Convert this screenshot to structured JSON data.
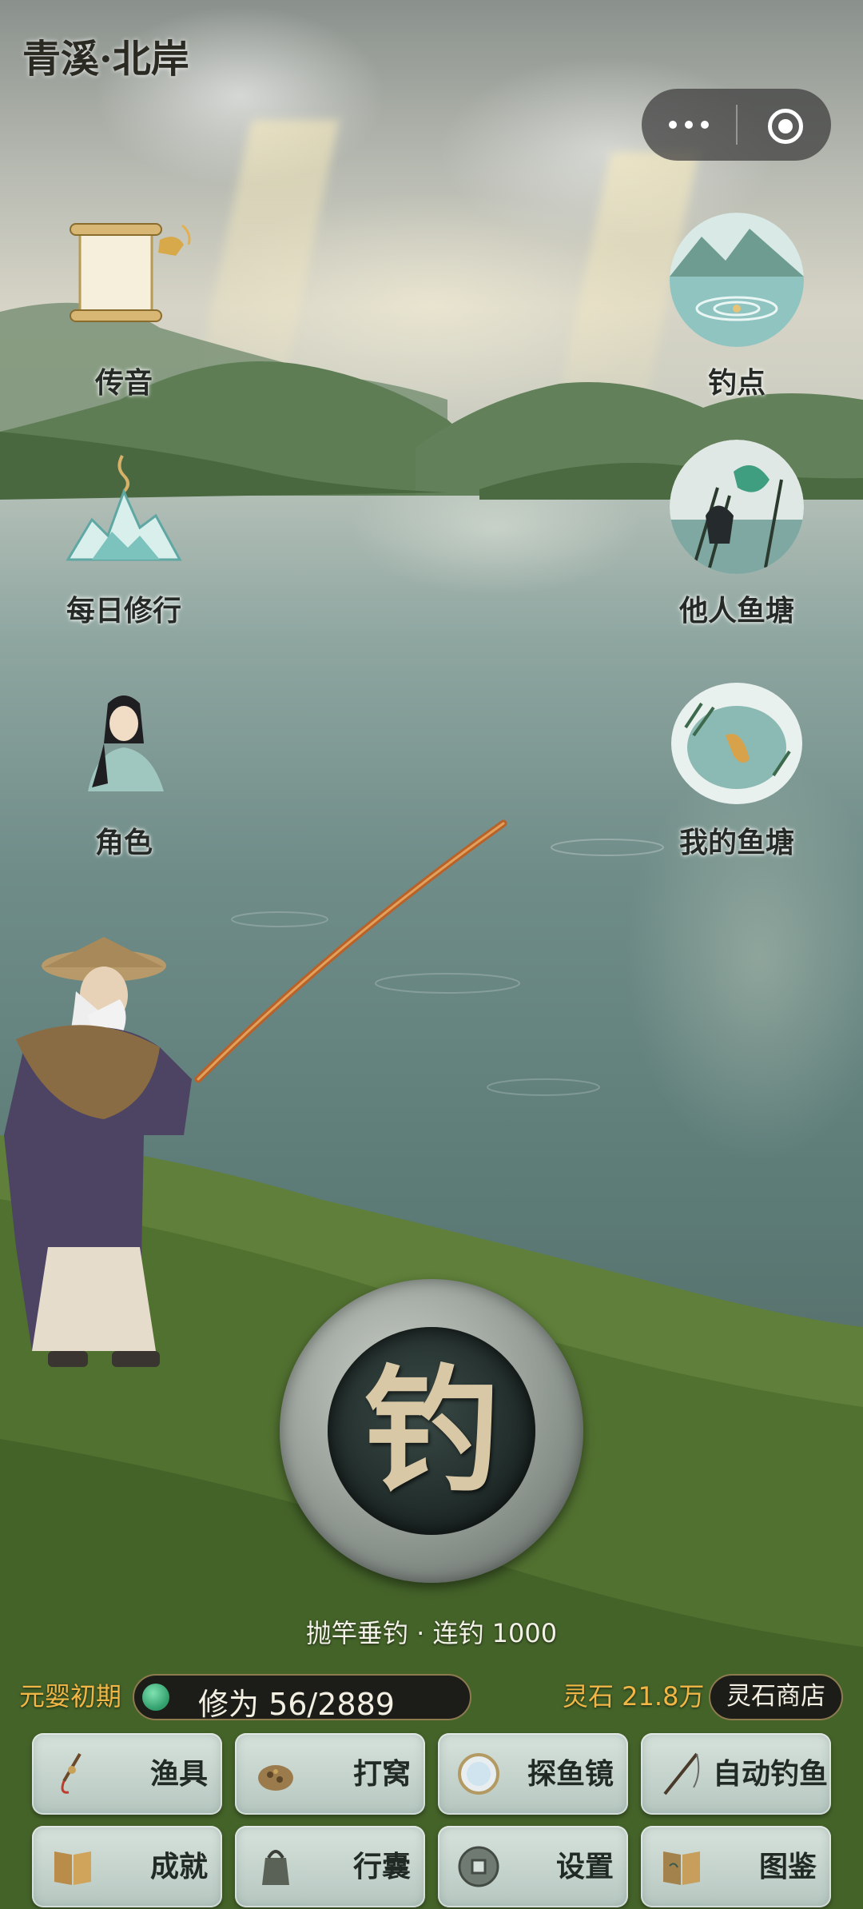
{
  "header": {
    "title": "青溪·北岸"
  },
  "capsule": {
    "more_icon": "more-dots-icon",
    "close_icon": "target-icon"
  },
  "left_menu": [
    {
      "label": "传音",
      "icon": "scroll-bell-icon"
    },
    {
      "label": "每日修行",
      "icon": "incense-mountain-icon"
    },
    {
      "label": "角色",
      "icon": "character-portrait-icon"
    }
  ],
  "right_menu": [
    {
      "label": "钓点",
      "icon": "lake-spot-icon"
    },
    {
      "label": "他人鱼塘",
      "icon": "others-pond-icon"
    },
    {
      "label": "我的鱼塘",
      "icon": "my-pond-icon"
    }
  ],
  "cast": {
    "button_char": "钓",
    "caption": "抛竿垂钓 · 连钓 1000"
  },
  "status": {
    "realm": "元婴初期",
    "cultivation": "修为 56/2889",
    "spirit_stones": "灵石 21.8万",
    "shop_label": "灵石商店"
  },
  "actions": [
    {
      "label": "渔具",
      "icon": "fishing-gear-icon"
    },
    {
      "label": "打窝",
      "icon": "bait-icon"
    },
    {
      "label": "探鱼镜",
      "icon": "fish-mirror-icon"
    },
    {
      "label": "自动钓鱼",
      "icon": "fishing-rod-icon"
    },
    {
      "label": "成就",
      "icon": "achievement-book-icon"
    },
    {
      "label": "行囊",
      "icon": "bag-icon"
    },
    {
      "label": "设置",
      "icon": "settings-coin-icon"
    },
    {
      "label": "图鉴",
      "icon": "codex-book-icon"
    }
  ],
  "colors": {
    "gold": "#f1b746",
    "dark_pill": "#1c1c18",
    "tile_bg": "#c8d6cf"
  }
}
